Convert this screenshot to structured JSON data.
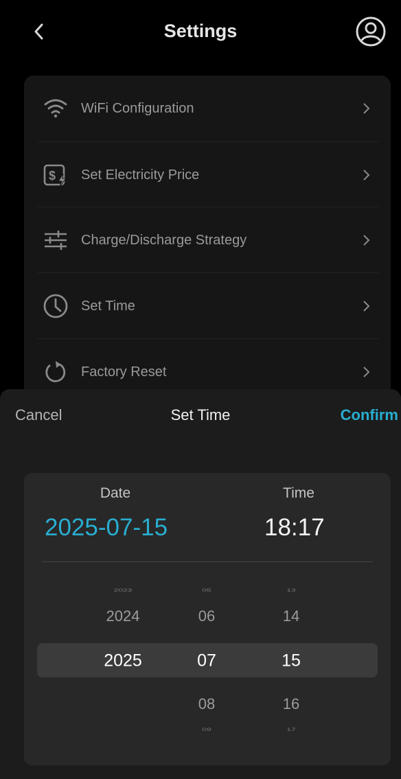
{
  "header": {
    "title": "Settings",
    "back_icon": "chevron-left-icon",
    "profile_icon": "user-circle-icon"
  },
  "settings": {
    "items": [
      {
        "label": "WiFi Configuration",
        "icon": "wifi-icon"
      },
      {
        "label": "Set Electricity Price",
        "icon": "dollar-bolt-icon"
      },
      {
        "label": "Charge/Discharge Strategy",
        "icon": "sliders-icon"
      },
      {
        "label": "Set Time",
        "icon": "clock-icon"
      },
      {
        "label": "Factory Reset",
        "icon": "refresh-icon"
      }
    ]
  },
  "sheet": {
    "title": "Set Time",
    "cancel": "Cancel",
    "confirm": "Confirm",
    "date_label": "Date",
    "time_label": "Time",
    "date_value": "2025-07-15",
    "time_value": "18:17"
  },
  "wheels": {
    "year": [
      "2023",
      "2024",
      "2025"
    ],
    "month": [
      "05",
      "06",
      "07",
      "08",
      "09"
    ],
    "day": [
      "13",
      "14",
      "15",
      "16",
      "17"
    ]
  },
  "colors": {
    "accent": "#29aed1",
    "background": "#000000",
    "card": "#161616",
    "sheet": "#1c1c1c"
  }
}
